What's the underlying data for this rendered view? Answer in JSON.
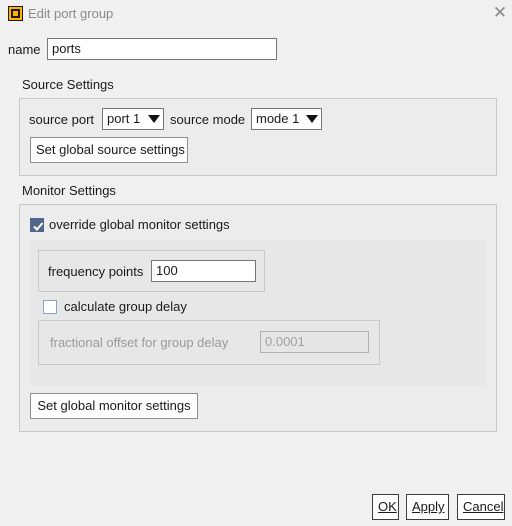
{
  "window": {
    "title": "Edit port group",
    "close_icon": "close-icon"
  },
  "name_field": {
    "label": "name",
    "value": "ports"
  },
  "source_settings": {
    "title": "Source Settings",
    "source_port_label": "source port",
    "source_port_value": "port 1",
    "source_mode_label": "source mode",
    "source_mode_value": "mode 1",
    "global_button": "Set global source settings"
  },
  "monitor_settings": {
    "title": "Monitor Settings",
    "override_label": "override global monitor settings",
    "override_checked": true,
    "frequency_points_label": "frequency points",
    "frequency_points_value": "100",
    "group_delay_label": "calculate group delay",
    "group_delay_checked": false,
    "offset_label": "fractional offset for group delay",
    "offset_value": "0.0001",
    "global_button": "Set global monitor settings"
  },
  "footer": {
    "ok": "OK",
    "apply": "Apply",
    "cancel": "Cancel"
  },
  "colors": {
    "checkbox_checked": "#51668b",
    "app_icon_accent": "#ffb400"
  }
}
